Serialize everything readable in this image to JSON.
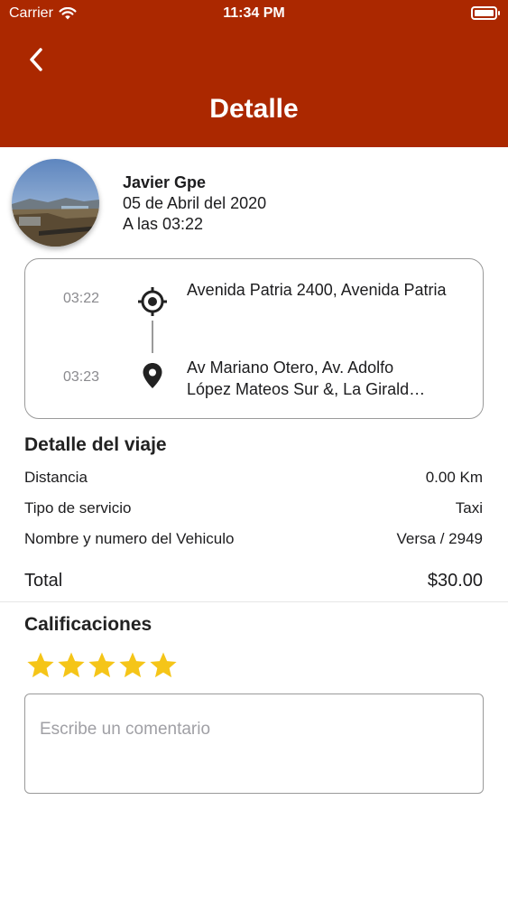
{
  "status_bar": {
    "carrier": "Carrier",
    "time": "11:34 PM"
  },
  "header": {
    "title": "Detalle",
    "back_icon": "chevron-left-icon",
    "background_color": "#ab2800"
  },
  "user": {
    "name": "Javier Gpe",
    "date": "05 de Abril del 2020",
    "time": "A las 03:22"
  },
  "route": {
    "origin": {
      "time": "03:22",
      "address": "Avenida Patria 2400, Avenida Patria",
      "icon": "crosshair-icon"
    },
    "destination": {
      "time": "03:23",
      "address_line1": "Av Mariano Otero, Av. Adolfo",
      "address_line2": "López Mateos Sur &, La Girald…",
      "icon": "map-pin-icon"
    }
  },
  "trip_details": {
    "title": "Detalle del viaje",
    "rows": [
      {
        "label": "Distancia",
        "value": "0.00 Km"
      },
      {
        "label": "Tipo de servicio",
        "value": "Taxi"
      },
      {
        "label": "Nombre y numero del Vehiculo",
        "value": "Versa / 2949"
      }
    ],
    "total_label": "Total",
    "total_value": "$30.00"
  },
  "ratings": {
    "title": "Calificaciones",
    "stars_filled": 5,
    "stars_total": 5,
    "star_color": "#f5c518",
    "comment_placeholder": "Escribe un comentario"
  }
}
